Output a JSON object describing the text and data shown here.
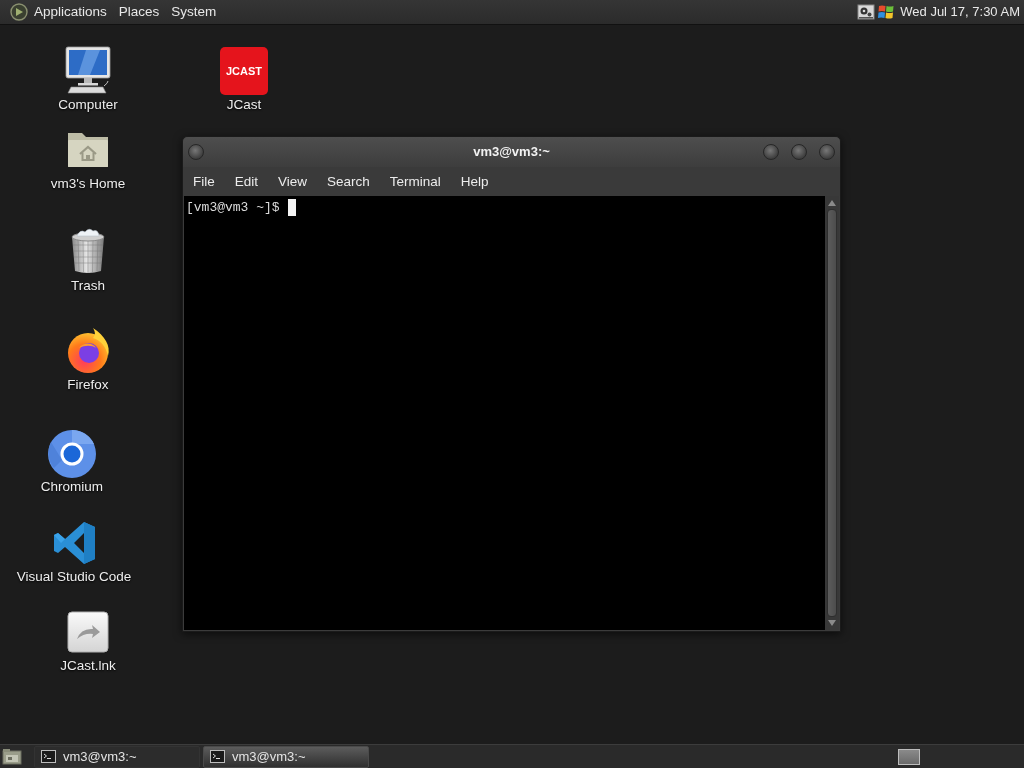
{
  "top_panel": {
    "menus": [
      "Applications",
      "Places",
      "System"
    ],
    "clock": "Wed Jul 17, 7:30 AM"
  },
  "desktop_icons": [
    {
      "kind": "computer",
      "label": "Computer"
    },
    {
      "kind": "app_logo",
      "logo_text": "JCAST",
      "label": "JCast"
    },
    {
      "kind": "folder",
      "label": "vm3's Home"
    },
    {
      "kind": "trash",
      "label": "Trash"
    },
    {
      "kind": "flame_globe",
      "label": "Firefox"
    },
    {
      "kind": "ring_globe",
      "label": "Chromium"
    },
    {
      "kind": "ribbon",
      "label": "Visual Studio Code"
    },
    {
      "kind": "shortcut",
      "label": "JCast.lnk"
    }
  ],
  "terminal_window": {
    "title": "vm3@vm3:~",
    "menus": [
      "File",
      "Edit",
      "View",
      "Search",
      "Terminal",
      "Help"
    ],
    "prompt": "[vm3@vm3 ~]$"
  },
  "taskbar": {
    "tasks": [
      {
        "label": "vm3@vm3:~",
        "selected": false
      },
      {
        "label": "vm3@vm3:~",
        "selected": true
      }
    ]
  }
}
